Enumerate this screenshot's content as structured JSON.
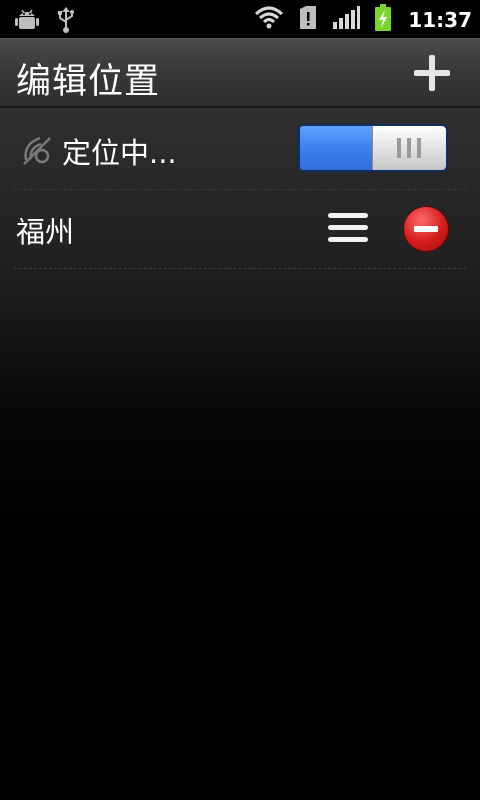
{
  "status_bar": {
    "time": "11:37",
    "icons": [
      "android-debug-icon",
      "usb-icon",
      "wifi-icon",
      "sd-card-alert-icon",
      "signal-icon",
      "battery-charging-icon"
    ]
  },
  "header": {
    "title": "编辑位置",
    "add_icon": "plus-icon"
  },
  "list": {
    "locating_row": {
      "label": "定位中...",
      "icon": "location-searching-icon",
      "toggle_on": true
    },
    "cities": [
      {
        "label": "福州",
        "drag_icon": "drag-handle-icon",
        "remove_icon": "remove-icon"
      }
    ]
  },
  "colors": {
    "toggle_on": "#3d80ee",
    "remove": "#d41b1b",
    "battery": "#7bd32e"
  }
}
